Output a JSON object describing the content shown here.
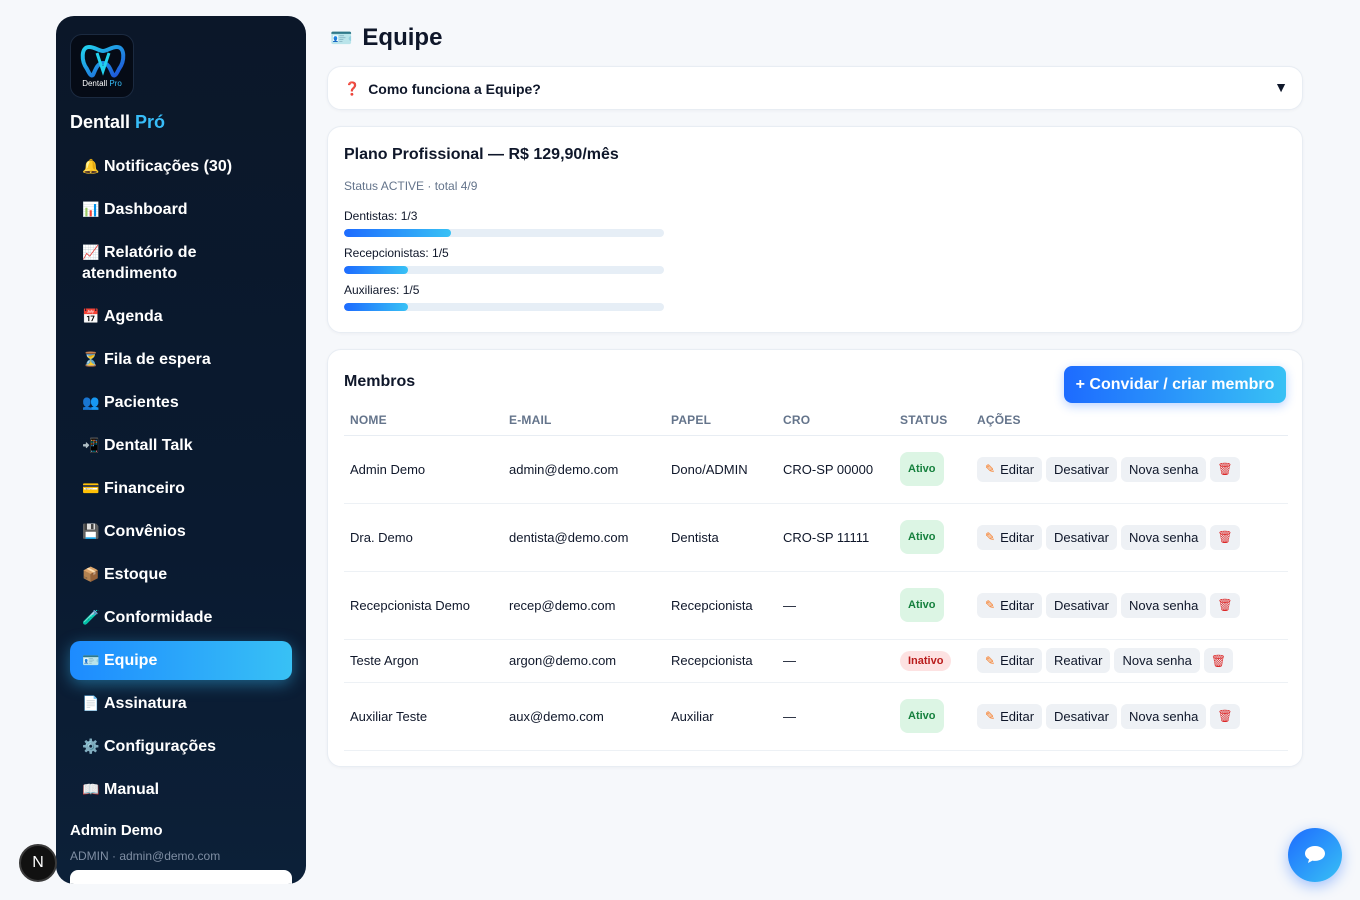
{
  "app": {
    "logo_caption_main": "Dentall",
    "logo_caption_pro": "Pro",
    "brand_main": "Dentall",
    "brand_accent": "Pró"
  },
  "sidebar": {
    "items": [
      {
        "icon": "🔔",
        "label": "Notificações (30)"
      },
      {
        "icon": "📊",
        "label": "Dashboard"
      },
      {
        "icon": "📈",
        "label": "Relatório de atendimento"
      },
      {
        "icon": "📅",
        "label": "Agenda"
      },
      {
        "icon": "⏳",
        "label": "Fila de espera"
      },
      {
        "icon": "👥",
        "label": "Pacientes"
      },
      {
        "icon": "📲",
        "label": "Dentall Talk"
      },
      {
        "icon": "💳",
        "label": "Financeiro"
      },
      {
        "icon": "💾",
        "label": "Convênios"
      },
      {
        "icon": "📦",
        "label": "Estoque"
      },
      {
        "icon": "🧪",
        "label": "Conformidade"
      },
      {
        "icon": "🪪",
        "label": "Equipe"
      },
      {
        "icon": "📄",
        "label": "Assinatura"
      },
      {
        "icon": "⚙️",
        "label": "Configurações"
      },
      {
        "icon": "📖",
        "label": "Manual"
      }
    ],
    "active_item": "Equipe",
    "user_name": "Admin Demo",
    "user_meta": "ADMIN · admin@demo.com"
  },
  "dev_badge": "N",
  "page": {
    "icon": "🪪",
    "title": "Equipe"
  },
  "faq": {
    "icon": "❓",
    "question": "Como funciona a Equipe?",
    "caret": "▼"
  },
  "plan": {
    "title": "Plano Profissional — R$ 129,90/mês",
    "status": "Status ACTIVE · total 4/9",
    "quotas": [
      {
        "label": "Dentistas: 1/3",
        "fraction": 0.3333
      },
      {
        "label": "Recepcionistas: 1/5",
        "fraction": 0.2
      },
      {
        "label": "Auxiliares: 1/5",
        "fraction": 0.2
      }
    ]
  },
  "members": {
    "title": "Membros",
    "invite_label": "+ Convidar / criar membro",
    "columns": [
      "NOME",
      "E-MAIL",
      "PAPEL",
      "CRO",
      "STATUS",
      "AÇÕES"
    ],
    "rows": [
      {
        "name": "Admin Demo",
        "email": "admin@demo.com",
        "role": "Dono/ADMIN",
        "cro": "CRO-SP 00000",
        "status": "Ativo",
        "toggle": "Desativar"
      },
      {
        "name": "Dra. Demo",
        "email": "dentista@demo.com",
        "role": "Dentista",
        "cro": "CRO-SP 11111",
        "status": "Ativo",
        "toggle": "Desativar"
      },
      {
        "name": "Recepcionista Demo",
        "email": "recep@demo.com",
        "role": "Recepcionista",
        "cro": "—",
        "status": "Ativo",
        "toggle": "Desativar"
      },
      {
        "name": "Teste Argon",
        "email": "argon@demo.com",
        "role": "Recepcionista",
        "cro": "—",
        "status": "Inativo",
        "toggle": "Reativar"
      },
      {
        "name": "Auxiliar Teste",
        "email": "aux@demo.com",
        "role": "Auxiliar",
        "cro": "—",
        "status": "Ativo",
        "toggle": "Desativar"
      }
    ],
    "edit_label": "Editar",
    "reset_label": "Nova senha",
    "delete_icon": "🗑"
  },
  "colors": {
    "accent": "#1d6bff",
    "accent_light": "#38c1f5",
    "sidebar_bg": "#0b1729",
    "active_bg": "#dcf5e4",
    "inactive_bg": "#fde2e2"
  }
}
